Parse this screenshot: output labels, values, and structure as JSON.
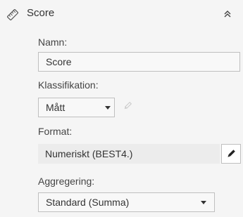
{
  "header": {
    "title": "Score",
    "icon": "ruler-icon",
    "collapse_icon": "chevron-up-double-icon"
  },
  "name_field": {
    "label": "Namn:",
    "value": "Score"
  },
  "classification": {
    "label": "Klassifikation:",
    "selected": "Mått",
    "edit_icon": "pencil-icon"
  },
  "format": {
    "label": "Format:",
    "value": "Numeriskt (BEST4.)",
    "edit_icon": "pencil-icon"
  },
  "aggregation": {
    "label": "Aggregering:",
    "selected": "Standard (Summa)"
  },
  "colors": {
    "panel_bg": "#f5f5f5",
    "field_border": "#bfbfbf",
    "readonly_field_bg": "#ececec"
  }
}
